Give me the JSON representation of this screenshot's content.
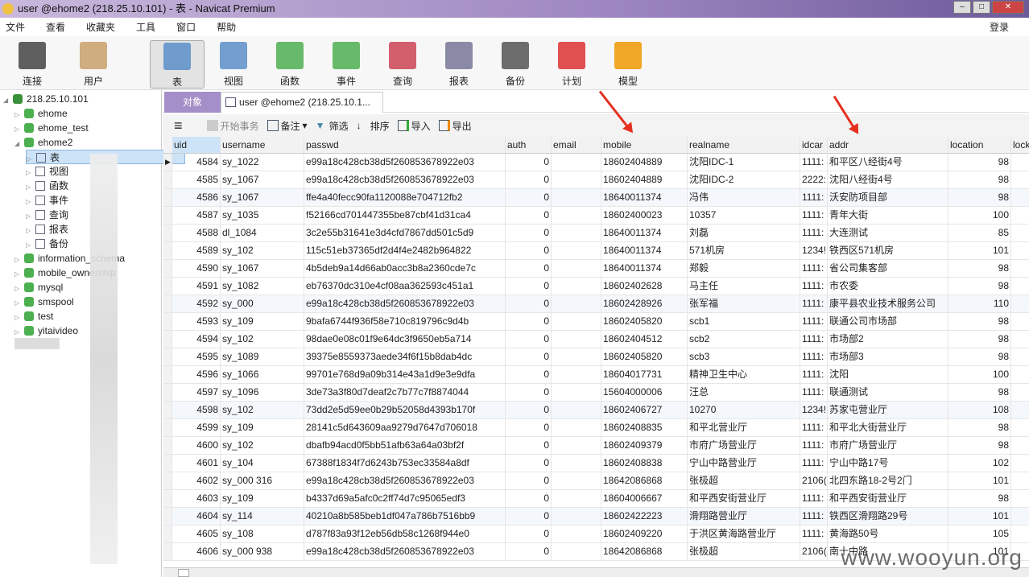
{
  "window": {
    "title": "user @ehome2 (218.25.10.101) - 表 - Navicat Premium"
  },
  "menu": [
    "文件",
    "查看",
    "收藏夹",
    "工具",
    "窗口",
    "帮助"
  ],
  "login": "登录",
  "toolbar": [
    {
      "label": "连接",
      "icon": "connection-icon"
    },
    {
      "label": "用户",
      "icon": "user-icon"
    },
    {
      "label": "表",
      "icon": "table-icon"
    },
    {
      "label": "视图",
      "icon": "view-icon"
    },
    {
      "label": "函数",
      "icon": "function-icon"
    },
    {
      "label": "事件",
      "icon": "event-icon"
    },
    {
      "label": "查询",
      "icon": "query-icon"
    },
    {
      "label": "报表",
      "icon": "report-icon"
    },
    {
      "label": "备份",
      "icon": "backup-icon"
    },
    {
      "label": "计划",
      "icon": "schedule-icon"
    },
    {
      "label": "模型",
      "icon": "model-icon"
    }
  ],
  "sidebar": {
    "server": "218.25.10.101",
    "dbs_top": [
      "ehome",
      "ehome_test",
      "ehome2"
    ],
    "children": [
      "表",
      "视图",
      "函数",
      "事件",
      "查询",
      "报表",
      "备份"
    ],
    "dbs_bottom": [
      "information_schema",
      "mobile_ownership",
      "mysql",
      "smspool",
      "test",
      "yitaivideo"
    ]
  },
  "tabs": {
    "objects": "对象",
    "current": "user @ehome2 (218.25.10.1..."
  },
  "subtoolbar": {
    "begin_tx": "开始事务",
    "note": "备注",
    "filter": "筛选",
    "sort": "排序",
    "import": "导入",
    "export": "导出"
  },
  "columns": [
    "uid",
    "username",
    "passwd",
    "auth",
    "email",
    "mobile",
    "realname",
    "idcar",
    "addr",
    "location",
    "lock"
  ],
  "rows": [
    [
      "4584",
      "sy_1022",
      "e99a18c428cb38d5f260853678922e03",
      "0",
      "",
      "18602404889",
      "沈阳IDC-1",
      "1111:",
      "和平区八经街4号",
      "98"
    ],
    [
      "4585",
      "sy_1067",
      "e99a18c428cb38d5f260853678922e03",
      "0",
      "",
      "18602404889",
      "沈阳IDC-2",
      "2222:",
      "沈阳八经街4号",
      "98"
    ],
    [
      "4586",
      "sy_1067",
      "ffe4a40fecc90fa1120088e704712fb2",
      "0",
      "",
      "18640011374",
      "冯伟",
      "1111:",
      "沃安防项目部",
      "98"
    ],
    [
      "4587",
      "sy_1035",
      "f52166cd701447355be87cbf41d31ca4",
      "0",
      "",
      "18602400023",
      "10357",
      "1111:",
      "青年大街",
      "100"
    ],
    [
      "4588",
      "dl_1084",
      "3c2e55b31641e3d4cfd7867dd501c5d9",
      "0",
      "",
      "18640011374",
      "刘磊",
      "1111:",
      "大连测试",
      "85"
    ],
    [
      "4589",
      "sy_102",
      "115c51eb37365df2d4f4e2482b964822",
      "0",
      "",
      "18640011374",
      "571机房",
      "1234!",
      "铁西区571机房",
      "101"
    ],
    [
      "4590",
      "sy_1067",
      "4b5deb9a14d66ab0acc3b8a2360cde7c",
      "0",
      "",
      "18640011374",
      "郑毅",
      "1111:",
      "省公司集客部",
      "98"
    ],
    [
      "4591",
      "sy_1082",
      "eb76370dc310e4cf08aa362593c451a1",
      "0",
      "",
      "18602402628",
      "马主任",
      "1111:",
      "市农委",
      "98"
    ],
    [
      "4592",
      "sy_000",
      "e99a18c428cb38d5f260853678922e03",
      "0",
      "",
      "18602428926",
      "张军福",
      "1111:",
      "康平县农业技术服务公司",
      "110"
    ],
    [
      "4593",
      "sy_109",
      "9bafa6744f936f58e710c819796c9d4b",
      "0",
      "",
      "18602405820",
      "scb1",
      "1111:",
      "联通公司市场部",
      "98"
    ],
    [
      "4594",
      "sy_102",
      "98dae0e08c01f9e64dc3f9650eb5a714",
      "0",
      "",
      "18602404512",
      "scb2",
      "1111:",
      "市场部2",
      "98"
    ],
    [
      "4595",
      "sy_1089",
      "39375e8559373aede34f6f15b8dab4dc",
      "0",
      "",
      "18602405820",
      "scb3",
      "1111:",
      "市场部3",
      "98"
    ],
    [
      "4596",
      "sy_1066",
      "99701e768d9a09b314e43a1d9e3e9dfa",
      "0",
      "",
      "18604017731",
      "精神卫生中心",
      "1111:",
      "沈阳",
      "100"
    ],
    [
      "4597",
      "sy_1096",
      "3de73a3f80d7deaf2c7b77c7f8874044",
      "0",
      "",
      "15604000006",
      "汪总",
      "1111:",
      "联通测试",
      "98"
    ],
    [
      "4598",
      "sy_102",
      "73dd2e5d59ee0b29b52058d4393b170f",
      "0",
      "",
      "18602406727",
      "10270",
      "1234!",
      "苏家屯营业厅",
      "108"
    ],
    [
      "4599",
      "sy_109",
      "28141c5d643609aa9279d7647d706018",
      "0",
      "",
      "18602408835",
      "和平北营业厅",
      "1111:",
      "和平北大街营业厅",
      "98"
    ],
    [
      "4600",
      "sy_102",
      "dbafb94acd0f5bb51afb63a64a03bf2f",
      "0",
      "",
      "18602409379",
      "市府广场营业厅",
      "1111:",
      "市府广场营业厅",
      "98"
    ],
    [
      "4601",
      "sy_104",
      "67388f1834f7d6243b753ec33584a8df",
      "0",
      "",
      "18602408838",
      "宁山中路营业厅",
      "1111:",
      "宁山中路17号",
      "102"
    ],
    [
      "4602",
      "sy_000   316",
      "e99a18c428cb38d5f260853678922e03",
      "0",
      "",
      "18642086868",
      "张极超",
      "2106(",
      "北四东路18-2号2门",
      "101"
    ],
    [
      "4603",
      "sy_109",
      "b4337d69a5afc0c2ff74d7c95065edf3",
      "0",
      "",
      "18604006667",
      "和平西安街营业厅",
      "1111:",
      "和平西安街营业厅",
      "98"
    ],
    [
      "4604",
      "sy_114",
      "40210a8b585beb1df047a786b7516bb9",
      "0",
      "",
      "18602422223",
      "滑翔路营业厅",
      "1111:",
      "铁西区滑翔路29号",
      "101"
    ],
    [
      "4605",
      "sy_108",
      "d787f83a93f12eb56db58c1268f944e0",
      "0",
      "",
      "18602409220",
      "于洪区黄海路营业厅",
      "1111:",
      "黄海路50号",
      "105"
    ],
    [
      "4606",
      "sy_000   938",
      "e99a18c428cb38d5f260853678922e03",
      "0",
      "",
      "18642086868",
      "张极超",
      "2106(",
      "南十中路",
      "101"
    ]
  ],
  "watermark": "www.wooyun.org"
}
